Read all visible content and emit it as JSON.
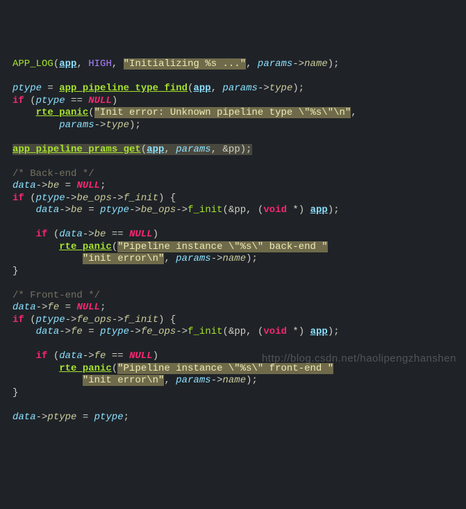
{
  "watermark": "http://blog.csdn.net/haolipengzhanshen",
  "t": {
    "APP_LOG": "APP_LOG",
    "app": "app",
    "HIGH": "HIGH",
    "str_init": "\"Initializing %s ...\"",
    "params": "params",
    "name": "name",
    "ptype": "ptype",
    "eq": " = ",
    "app_pipeline_type_find": "app_pipeline_type_find",
    "type": "type",
    "if": "if",
    "NULL": "NULL",
    "rte_panic": "rte_panic",
    "str_unknown": "\"Init error: Unknown pipeline type \\\"%s\\\"\\n\"",
    "app_pipeline_p": "app_pipeline_p",
    "rams_get": "rams_get",
    "amp_pp": "&pp",
    "cmt_back": "/* Back-end */",
    "data": "data",
    "be": "be",
    "be_ops": "be_ops",
    "f_init": "f_init",
    "void": "void",
    "star": " *",
    "str_be1": "\"Pipeline instance \\\"%s\\\" back-end \"",
    "str_be2": "\"init error\\n\"",
    "cmt_front": "/* Front-end */",
    "fe": "fe",
    "fe_ops": "fe_ops",
    "str_fe1": "\"Pipeline instance \\\"%s\\\" front-end \"",
    "str_fe2": "\"init error\\n\"",
    "space": " "
  }
}
